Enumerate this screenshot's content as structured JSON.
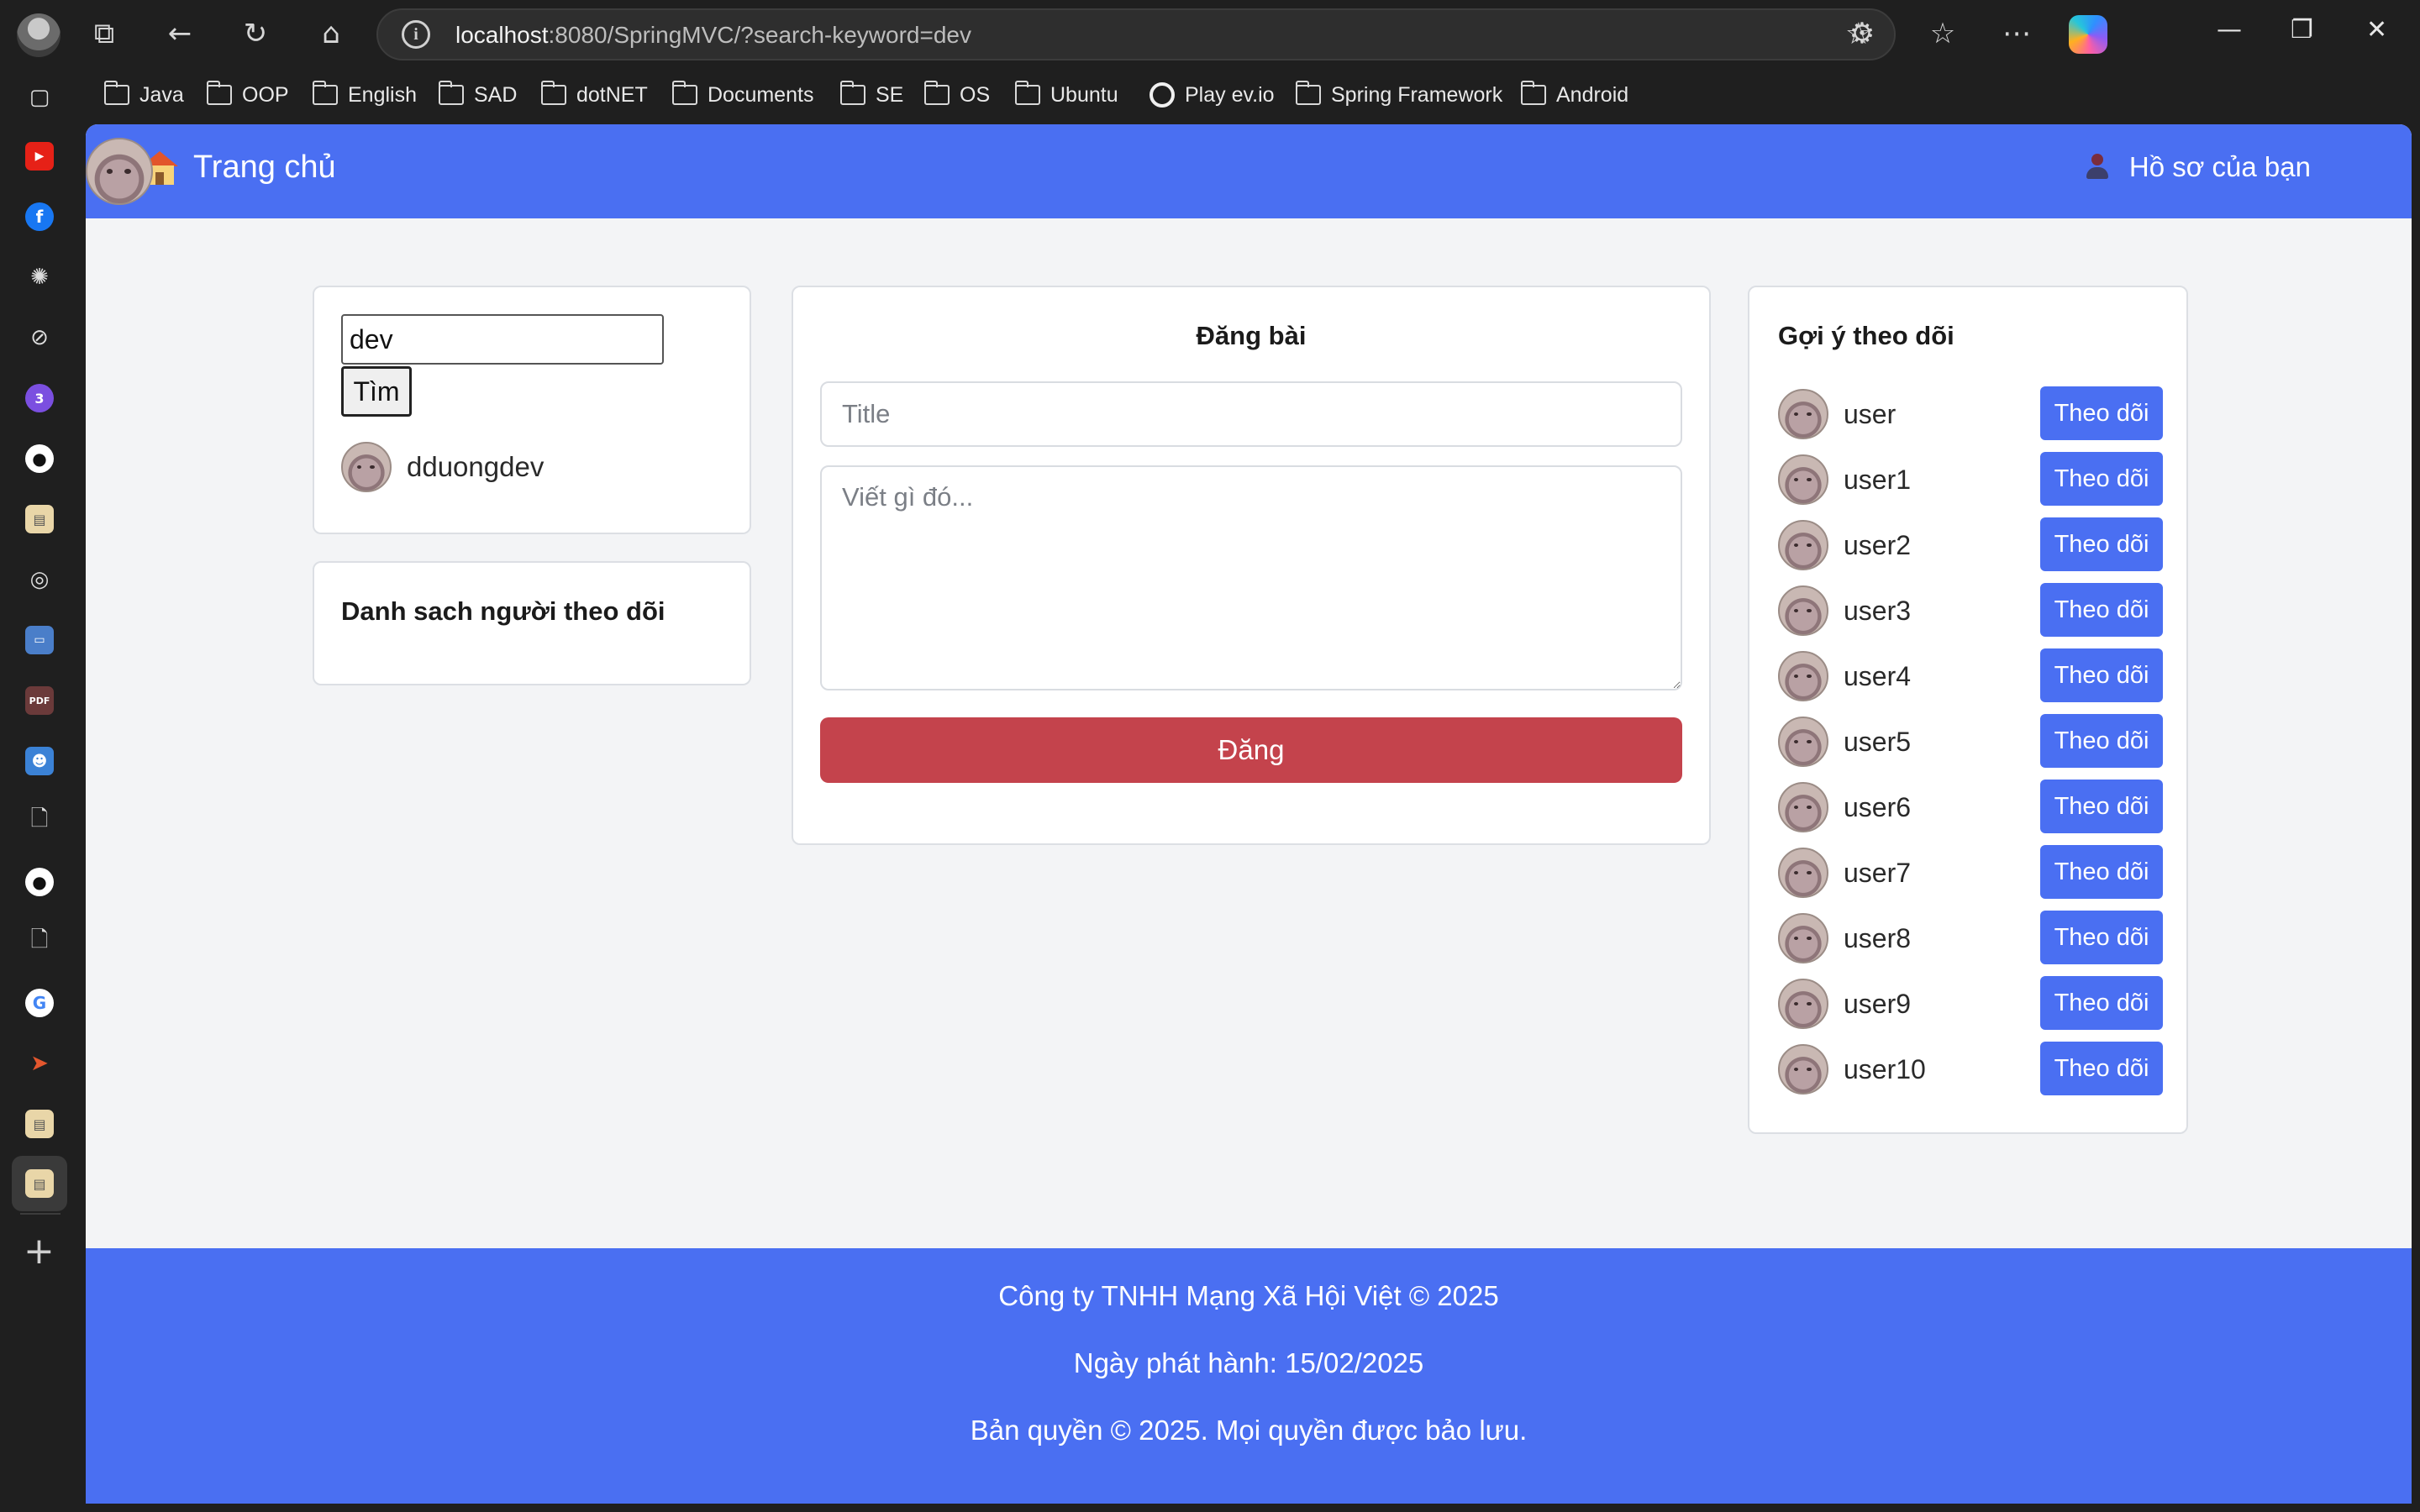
{
  "browser": {
    "url_host": "localhost",
    "url_rest": ":8080/SpringMVC/?search-keyword=dev",
    "bookmarks": [
      "Java",
      "OOP",
      "English",
      "SAD",
      "dotNET",
      "Documents",
      "SE",
      "OS",
      "Ubuntu",
      "Play ev.io",
      "Spring Framework",
      "Android"
    ],
    "sidebar_icons": [
      "youtube-icon",
      "facebook-icon",
      "chatgpt-icon",
      "perplexity-icon",
      "messenger-icon",
      "github-icon",
      "image-icon",
      "globe-icon",
      "monitor-icon",
      "pdf-icon",
      "contacts-icon",
      "document-icon",
      "github-icon",
      "document-icon",
      "google-icon",
      "arrow-app-icon",
      "image-icon"
    ]
  },
  "nav": {
    "home_label": "Trang chủ",
    "profile_label": "Hồ sơ của bạn"
  },
  "search": {
    "value": "dev",
    "button_label": "Tìm",
    "results": [
      {
        "username": "dduongdev"
      }
    ]
  },
  "followers": {
    "heading": "Danh sach người theo dõi"
  },
  "post": {
    "heading": "Đăng bài",
    "title_placeholder": "Title",
    "body_placeholder": "Viết gì đó...",
    "submit_label": "Đăng"
  },
  "suggestions": {
    "heading": "Gợi ý theo dõi",
    "follow_label": "Theo dõi",
    "users": [
      "user",
      "user1",
      "user2",
      "user3",
      "user4",
      "user5",
      "user6",
      "user7",
      "user8",
      "user9",
      "user10"
    ]
  },
  "footer": {
    "company": "Công ty TNHH Mạng Xã Hội Việt © 2025",
    "release": "Ngày phát hành: 15/02/2025",
    "copyright": "Bản quyền © 2025. Mọi quyền được bảo lưu."
  },
  "colors": {
    "brand": "#4a6ff2",
    "danger": "#c4434c",
    "page_bg": "#f3f4f6"
  }
}
